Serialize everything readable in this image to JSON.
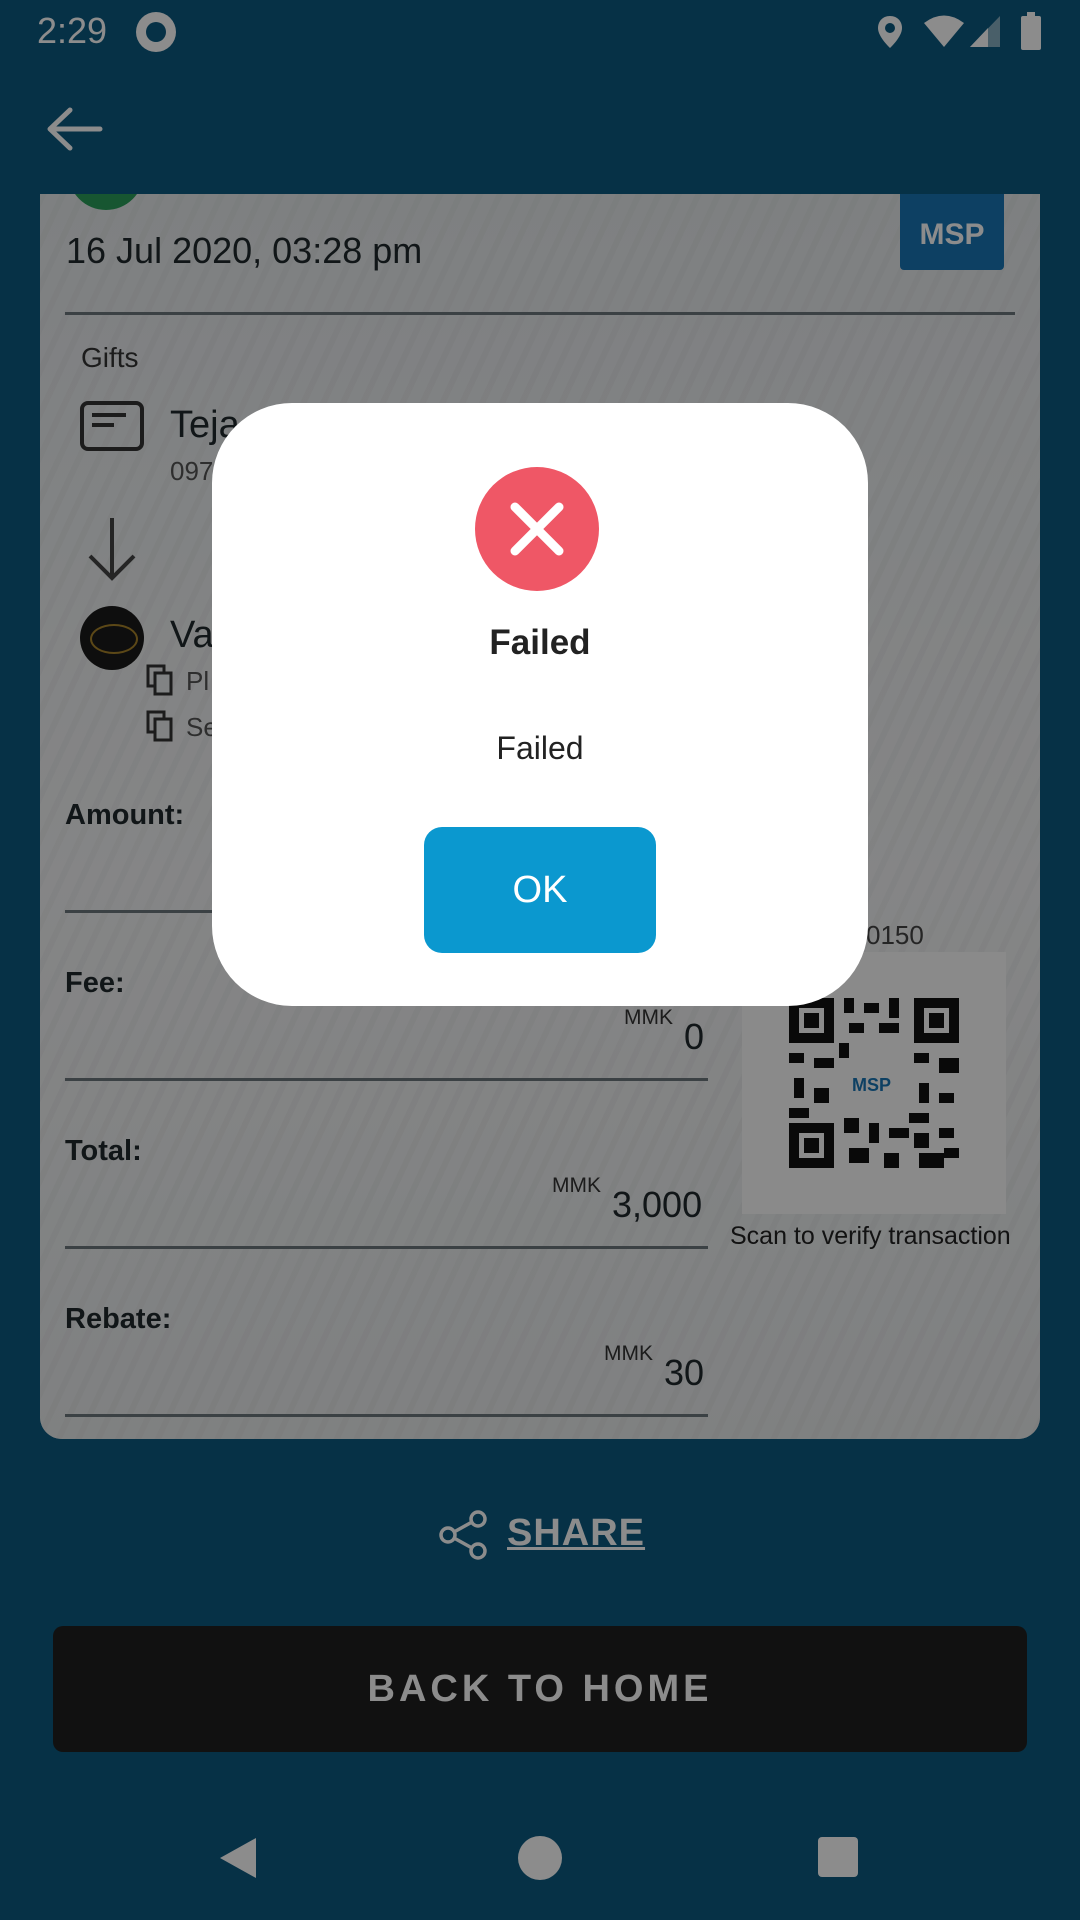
{
  "status_bar": {
    "time": "2:29"
  },
  "receipt": {
    "date": "16 Jul 2020, 03:28 pm",
    "badge": "MSP",
    "section_label": "Gifts",
    "sender_name_partial": "Teja",
    "sender_phone_partial": "097",
    "merchant_name_partial": "Va",
    "copy_line_1_partial": "Pl",
    "copy_line_2_partial": "Se",
    "amount_label": "Amount:",
    "fee": {
      "label": "Fee:",
      "currency": "MMK",
      "value": "0"
    },
    "total": {
      "label": "Total:",
      "currency": "MMK",
      "value": "3,000"
    },
    "rebate": {
      "label": "Rebate:",
      "currency": "MMK",
      "value": "30"
    },
    "txn_id_fragment": "0150",
    "qr_logo": "MSP",
    "scan_caption": "Scan to verify transaction"
  },
  "share_label": "SHARE",
  "back_home_label": "BACK TO HOME",
  "dialog": {
    "title": "Failed",
    "message": "Failed",
    "ok_label": "OK",
    "error_color": "#ef5766",
    "button_color": "#0b98cf"
  },
  "colors": {
    "app_bar": "#0b5a80",
    "back_home_button": "#202020"
  }
}
